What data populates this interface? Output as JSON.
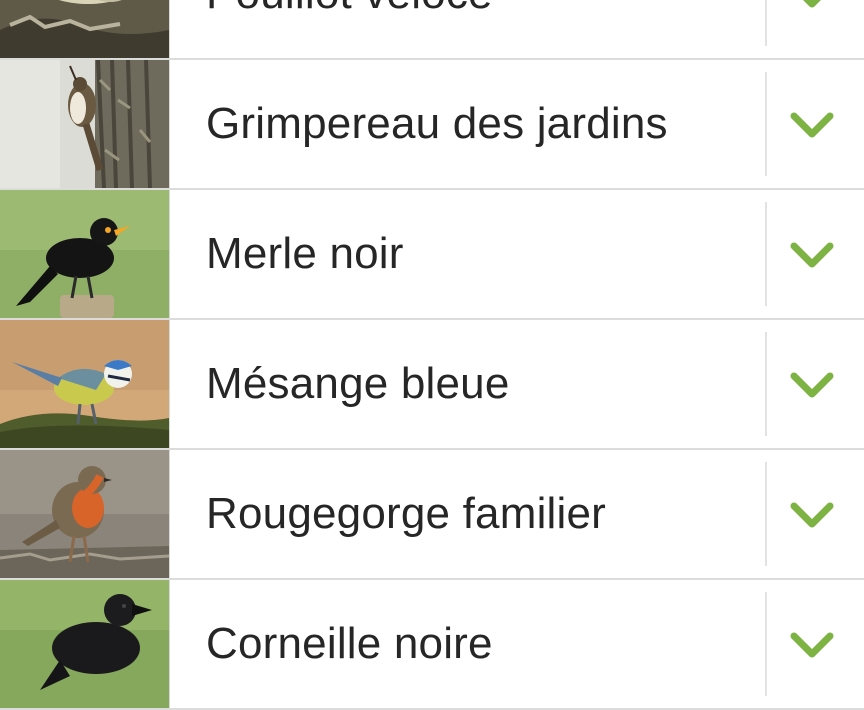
{
  "birds": [
    {
      "name": "Pouillot véloce",
      "photo": "bird-photo-pouillot",
      "chevron": "chevron-down-icon"
    },
    {
      "name": "Grimpereau des jardins",
      "photo": "bird-photo-grimpereau",
      "chevron": "chevron-down-icon"
    },
    {
      "name": "Merle noir",
      "photo": "bird-photo-merle",
      "chevron": "chevron-down-icon"
    },
    {
      "name": "Mésange bleue",
      "photo": "bird-photo-mesange",
      "chevron": "chevron-down-icon"
    },
    {
      "name": "Rougegorge familier",
      "photo": "bird-photo-rougegorge",
      "chevron": "chevron-down-icon"
    },
    {
      "name": "Corneille noire",
      "photo": "bird-photo-corneille",
      "chevron": "chevron-down-icon"
    }
  ],
  "colors": {
    "chevron": "#7cb342",
    "divider": "#e2e2e2",
    "text": "#262626"
  }
}
